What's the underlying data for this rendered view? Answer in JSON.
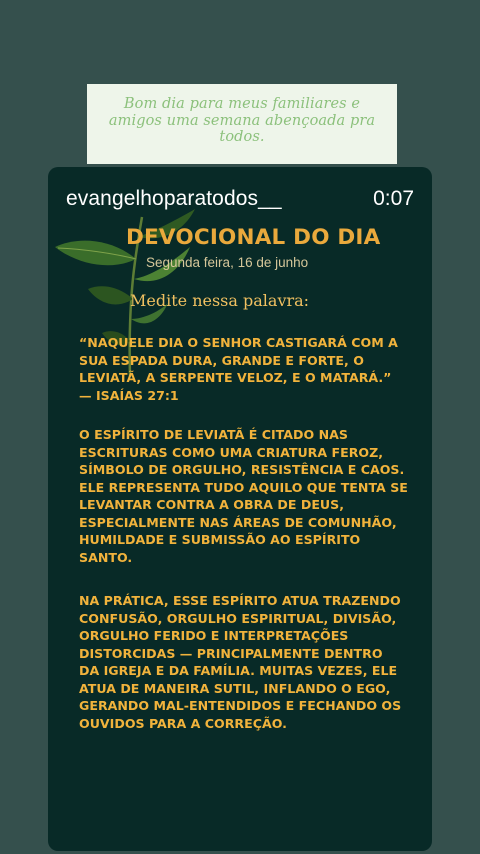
{
  "caption": {
    "lines": [
      "Bom dia para meus familiares e",
      "amigos uma semana abençoada pra",
      "todos."
    ]
  },
  "story": {
    "username": "evangelhoparatodos__",
    "time": "0:07",
    "title": "DEVOCIONAL DO DIA",
    "date": "Segunda feira, 16 de junho",
    "prompt": "Medite nessa palavra:",
    "verse_lines": [
      "“NAQUELE DIA O SENHOR CASTIGARÁ COM A",
      "SUA ESPADA DURA, GRANDE E FORTE, O",
      "LEVIATÃ, A SERPENTE VELOZ, E O MATARÁ.”",
      "— ISAÍAS 27:1"
    ],
    "paragraph1_lines": [
      "O ESPÍRITO DE LEVIATÃ É CITADO NAS",
      "ESCRITURAS COMO UMA CRIATURA FEROZ,",
      "SÍMBOLO DE ORGULHO, RESISTÊNCIA E CAOS.",
      "ELE REPRESENTA TUDO AQUILO QUE TENTA SE",
      "LEVANTAR CONTRA A OBRA DE DEUS,",
      "ESPECIALMENTE NAS ÁREAS DE COMUNHÃO,",
      "HUMILDADE E SUBMISSÃO AO ESPÍRITO",
      "SANTO."
    ],
    "paragraph2_lines": [
      "NA PRÁTICA, ESSE ESPÍRITO ATUA TRAZENDO",
      "CONFUSÃO, ORGULHO ESPIRITUAL, DIVISÃO,",
      "ORGULHO FERIDO E INTERPRETAÇÕES",
      "DISTORCIDAS — PRINCIPALMENTE DENTRO",
      "DA IGREJA E DA FAMÍLIA. MUITAS VEZES, ELE",
      "ATUA DE MANEIRA SUTIL, INFLANDO O EGO,",
      "GERANDO MAL-ENTENDIDOS E FECHANDO OS",
      "OUVIDOS PARA A CORREÇÃO."
    ]
  },
  "colors": {
    "page_bg": "#35504d",
    "caption_bg": "#eef5ea",
    "caption_text": "#8cc17c",
    "card_bg": "#082a27",
    "accent": "#f1b33c"
  },
  "icons": {
    "leaf_art": "leaf-branch-icon"
  }
}
